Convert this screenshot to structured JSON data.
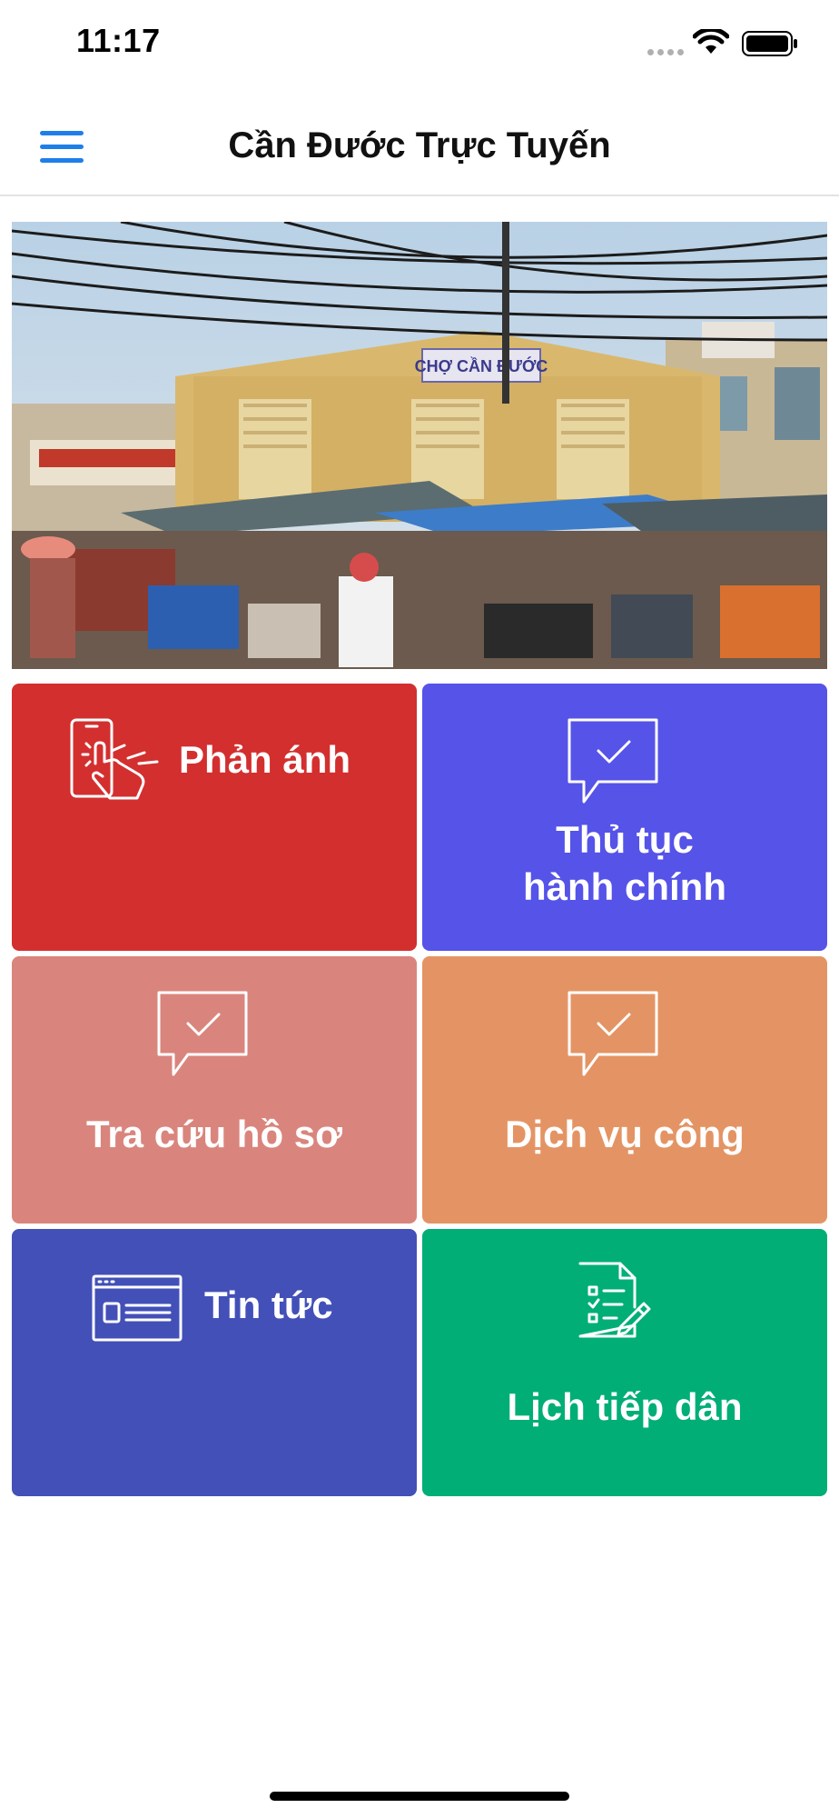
{
  "status_bar": {
    "time": "11:17"
  },
  "nav": {
    "title": "Cần Đước Trực Tuyến"
  },
  "banner": {
    "sign_text": "CHỢ CẦN ĐƯỚC"
  },
  "tiles": [
    {
      "label": "Phản ánh",
      "color": "#d32f2f",
      "icon": "touch-phone-icon"
    },
    {
      "label_line1": "Thủ tục",
      "label_line2": "hành chính",
      "color": "#5553e8",
      "icon": "chat-check-icon"
    },
    {
      "label": "Tra cứu hồ sơ",
      "color": "#d9857d",
      "icon": "chat-check-icon"
    },
    {
      "label": "Dịch vụ công",
      "color": "#e49464",
      "icon": "chat-check-icon"
    },
    {
      "label": "Tin tức",
      "color": "#4350b8",
      "icon": "browser-window-icon"
    },
    {
      "label": "Lịch tiếp dân",
      "color": "#00ae76",
      "icon": "document-checklist-icon"
    }
  ]
}
